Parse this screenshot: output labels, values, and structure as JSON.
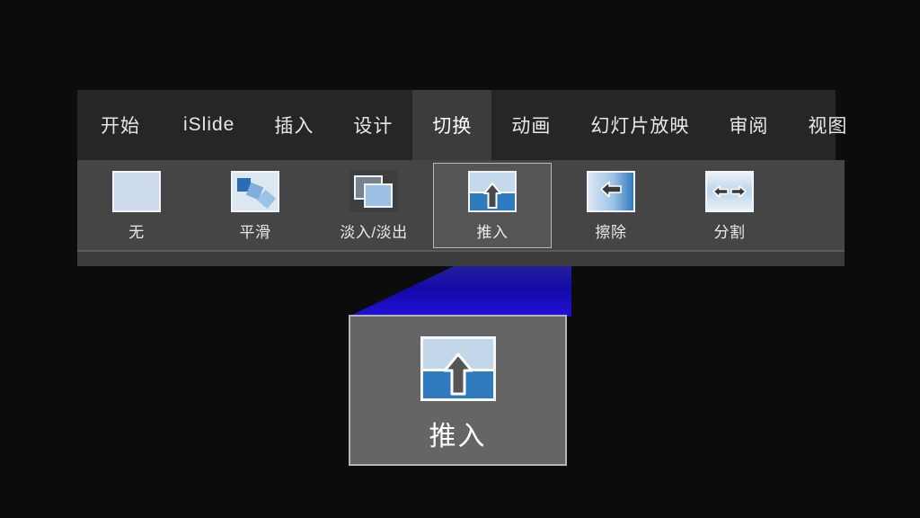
{
  "app": {
    "background_color": "#0c0c0c",
    "ribbon_background": "#454545",
    "tabbar_background": "#262626",
    "accent_blue": "#1a0fbf",
    "selected_item_border": "#b9b9b9"
  },
  "tabs": [
    {
      "label": "开始",
      "name": "tab-home",
      "active": false
    },
    {
      "label": "iSlide",
      "name": "tab-islide",
      "active": false
    },
    {
      "label": "插入",
      "name": "tab-insert",
      "active": false
    },
    {
      "label": "设计",
      "name": "tab-design",
      "active": false
    },
    {
      "label": "切换",
      "name": "tab-transitions",
      "active": true
    },
    {
      "label": "动画",
      "name": "tab-animations",
      "active": false
    },
    {
      "label": "幻灯片放映",
      "name": "tab-slideshow",
      "active": false
    },
    {
      "label": "审阅",
      "name": "tab-review",
      "active": false
    },
    {
      "label": "视图",
      "name": "tab-view",
      "active": false
    }
  ],
  "gallery": {
    "items": [
      {
        "label": "无",
        "icon": "none-transition-icon",
        "selected": false
      },
      {
        "label": "平滑",
        "icon": "morph-transition-icon",
        "selected": false
      },
      {
        "label": "淡入/淡出",
        "icon": "fade-transition-icon",
        "selected": false
      },
      {
        "label": "推入",
        "icon": "push-transition-icon",
        "selected": true
      },
      {
        "label": "擦除",
        "icon": "wipe-transition-icon",
        "selected": false
      },
      {
        "label": "分割",
        "icon": "split-transition-icon",
        "selected": false
      }
    ]
  },
  "magnifier": {
    "label": "推入",
    "icon": "push-transition-icon",
    "connector_color": "#1a0fbf",
    "card_background": "#656565"
  }
}
